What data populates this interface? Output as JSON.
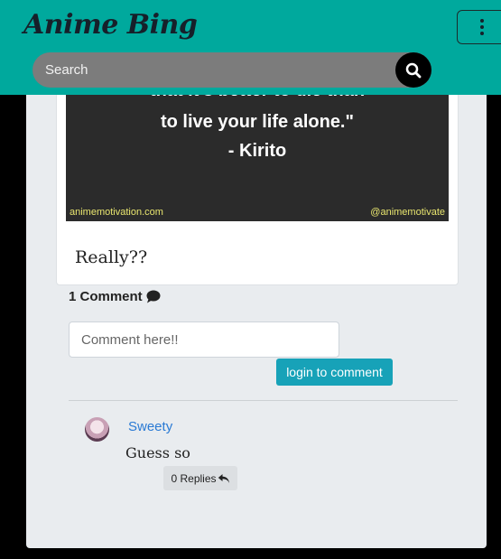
{
  "header": {
    "brand": "Anime Bing",
    "search_placeholder": "Search"
  },
  "post": {
    "quote_line1": "that it's better to die than",
    "quote_line2": "to live your life alone.\"",
    "quote_author": "- Kirito",
    "watermark_left": "animemotivation.com",
    "watermark_right": "@animemotivate",
    "text": "Really??"
  },
  "comments": {
    "count_label": "1 Comment",
    "input_placeholder": "Comment here!!",
    "login_button": "login to comment",
    "items": [
      {
        "username": "Sweety",
        "text": "Guess so",
        "replies_label": "0 Replies"
      }
    ]
  },
  "colors": {
    "header_bg": "#00a99d",
    "link": "#2a7ad4",
    "button_bg": "#17a2b8"
  }
}
